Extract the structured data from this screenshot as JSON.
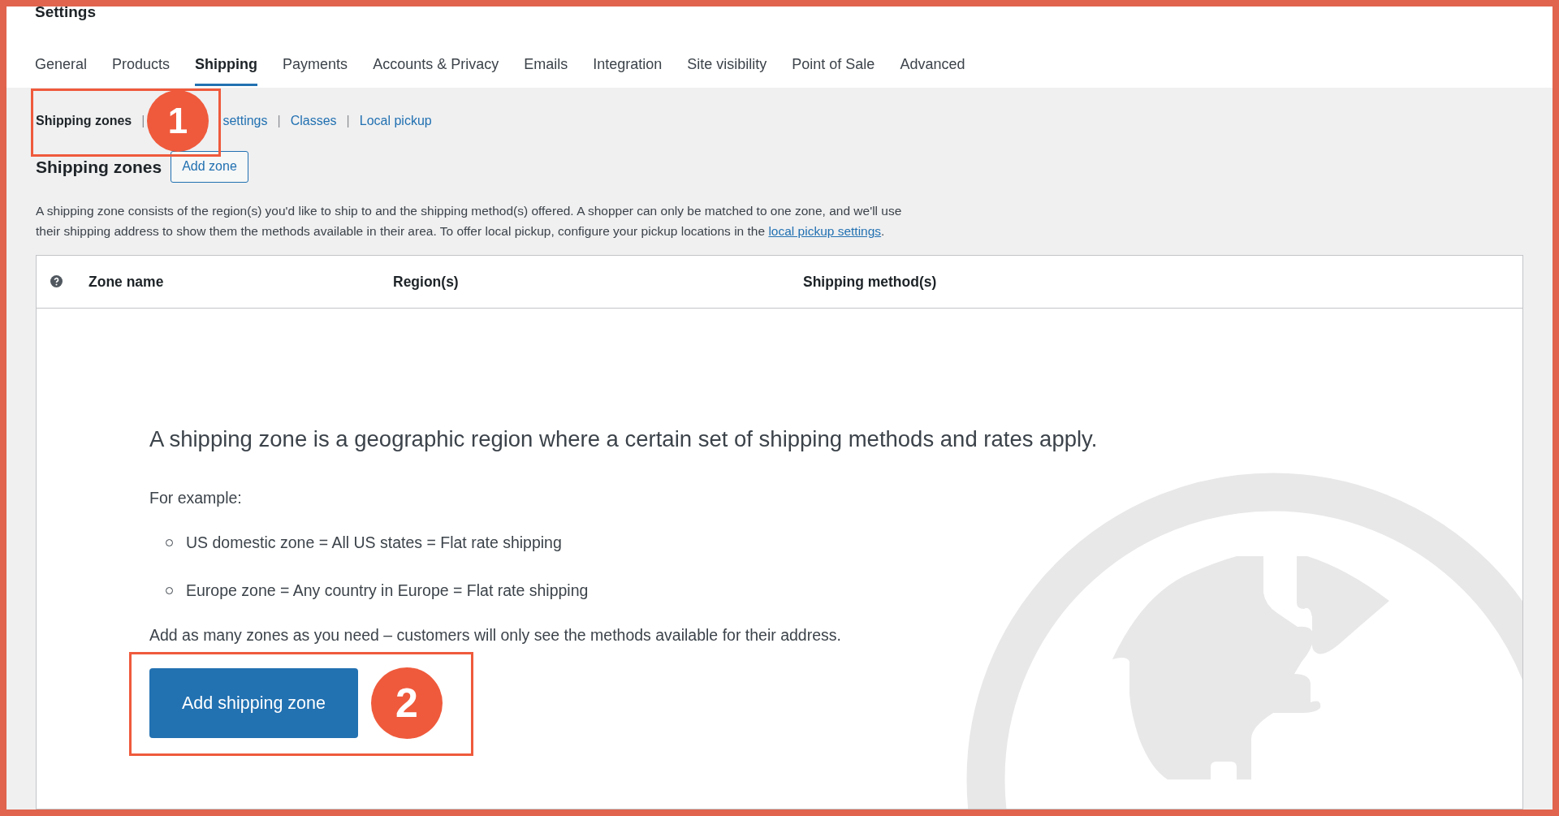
{
  "page": {
    "title": "Settings"
  },
  "tabs": [
    {
      "label": "General",
      "selected": false
    },
    {
      "label": "Products",
      "selected": false
    },
    {
      "label": "Shipping",
      "selected": true
    },
    {
      "label": "Payments",
      "selected": false
    },
    {
      "label": "Accounts & Privacy",
      "selected": false
    },
    {
      "label": "Emails",
      "selected": false
    },
    {
      "label": "Integration",
      "selected": false
    },
    {
      "label": "Site visibility",
      "selected": false
    },
    {
      "label": "Point of Sale",
      "selected": false
    },
    {
      "label": "Advanced",
      "selected": false
    }
  ],
  "subnav": [
    {
      "label": "Shipping zones",
      "selected": true
    },
    {
      "separator": "|",
      "label": "settings",
      "selected": false
    },
    {
      "separator": "|",
      "label": "Classes",
      "selected": false
    },
    {
      "separator": "|",
      "label": "Local pickup",
      "selected": false
    }
  ],
  "heading": "Shipping zones",
  "add_zone_button": "Add zone",
  "description": {
    "text": "A shipping zone consists of the region(s) you'd like to ship to and the shipping method(s) offered. A shopper can only be matched to one zone, and we'll use their shipping address to show them the methods available in their area. To offer local pickup, configure your pickup locations in the ",
    "link": "local pickup settings",
    "after": "."
  },
  "table": {
    "columns": [
      "Zone name",
      "Region(s)",
      "Shipping method(s)"
    ]
  },
  "empty_state": {
    "headline": "A shipping zone is a geographic region where a certain set of shipping methods and rates apply.",
    "intro": "For example:",
    "examples": [
      "US domestic zone = All US states = Flat rate shipping",
      "Europe zone = Any country in Europe = Flat rate shipping"
    ],
    "note": "Add as many zones as you need – customers will only see the methods available for their address.",
    "button": "Add shipping zone"
  },
  "annotations": [
    {
      "number": "1"
    },
    {
      "number": "2"
    }
  ]
}
